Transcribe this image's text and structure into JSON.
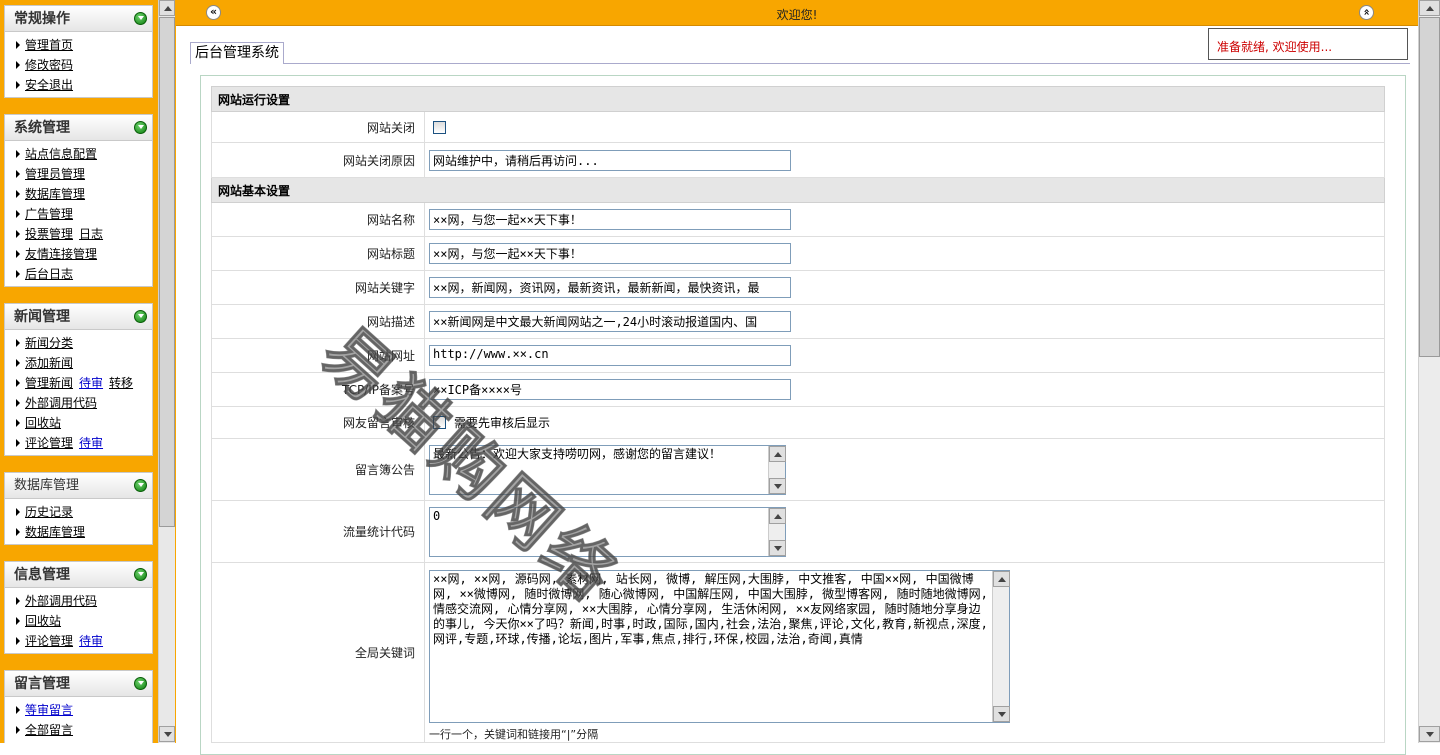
{
  "sidebar": {
    "groups": [
      {
        "title": "常规操作",
        "items": [
          {
            "label": "管理首页"
          },
          {
            "label": "修改密码"
          },
          {
            "label": "安全退出"
          }
        ]
      },
      {
        "title": "系统管理",
        "items": [
          {
            "label": "站点信息配置"
          },
          {
            "label": "管理员管理"
          },
          {
            "label": "数据库管理"
          },
          {
            "label": "广告管理"
          },
          {
            "label": "投票管理",
            "extra": "日志"
          },
          {
            "label": "友情连接管理"
          },
          {
            "label": "后台日志"
          }
        ]
      },
      {
        "title": "新闻管理",
        "items": [
          {
            "label": "新闻分类"
          },
          {
            "label": "添加新闻"
          },
          {
            "label": "管理新闻",
            "extra_blue": "待审",
            "extra": "转移"
          },
          {
            "label": "外部调用代码"
          },
          {
            "label": "回收站"
          },
          {
            "label": "评论管理",
            "extra_blue": "待审"
          }
        ]
      },
      {
        "title": "数据库管理",
        "items": [
          {
            "label": "历史记录"
          },
          {
            "label": "数据库管理"
          }
        ]
      },
      {
        "title": "信息管理",
        "items": [
          {
            "label": "外部调用代码"
          },
          {
            "label": "回收站"
          },
          {
            "label": "评论管理",
            "extra_blue": "待审"
          }
        ]
      },
      {
        "title": "留言管理",
        "items": [
          {
            "label": "等审留言"
          },
          {
            "label": "全部留言"
          }
        ]
      }
    ]
  },
  "topbar": {
    "welcome": "欢迎您!"
  },
  "status": {
    "text": "准备就绪, 欢迎使用..."
  },
  "page": {
    "tab": "后台管理系统"
  },
  "form": {
    "section_run": "网站运行设置",
    "close_label": "网站关闭",
    "close_reason_label": "网站关闭原因",
    "close_reason_value": "网站维护中，请稍后再访问...",
    "section_basic": "网站基本设置",
    "name_label": "网站名称",
    "name_value": "××网，与您一起××天下事！",
    "title_label": "网站标题",
    "title_value": "××网，与您一起××天下事！",
    "keywords_label": "网站关键字",
    "keywords_value": "××网，新闻网，资讯网，最新资讯，最新新闻，最快资讯，最",
    "desc_label": "网站描述",
    "desc_value": "××新闻网是中文最大新闻网站之一,24小时滚动报道国内、国",
    "url_label": "网站网址",
    "url_value": "http://www.××.cn",
    "icp_label": "TCP/IP备案号",
    "icp_value": "××ICP备××××号",
    "review_label": "网友留言审核",
    "review_text": "需要先审核后显示",
    "notice_label": "留言簿公告",
    "notice_value": "最新公告：欢迎大家支持唠叨网，感谢您的留言建议！",
    "stats_label": "流量统计代码",
    "stats_value": "0",
    "global_kw_label": "全局关键词",
    "global_kw_value": "××网, ××网, 源码网, 素材网, 站长网, 微博, 解压网,大围脖, 中文推客, 中国××网, 中国微博网, ××微博网, 随时微博网, 随心微博网, 中国解压网, 中国大围脖, 微型博客网, 随时随地微博网, 情感交流网, 心情分享网, ××大围脖, 心情分享网, 生活休闲网, ××友网络家园, 随时随地分享身边的事儿, 今天你××了吗？新闻,时事,时政,国际,国内,社会,法治,聚焦,评论,文化,教育,新视点,深度,网评,专题,环球,传播,论坛,图片,军事,焦点,排行,环保,校园,法治,奇闻,真情",
    "global_kw_hint": "一行一个，关键词和链接用“|”分隔"
  },
  "watermark": "易猫购网络"
}
